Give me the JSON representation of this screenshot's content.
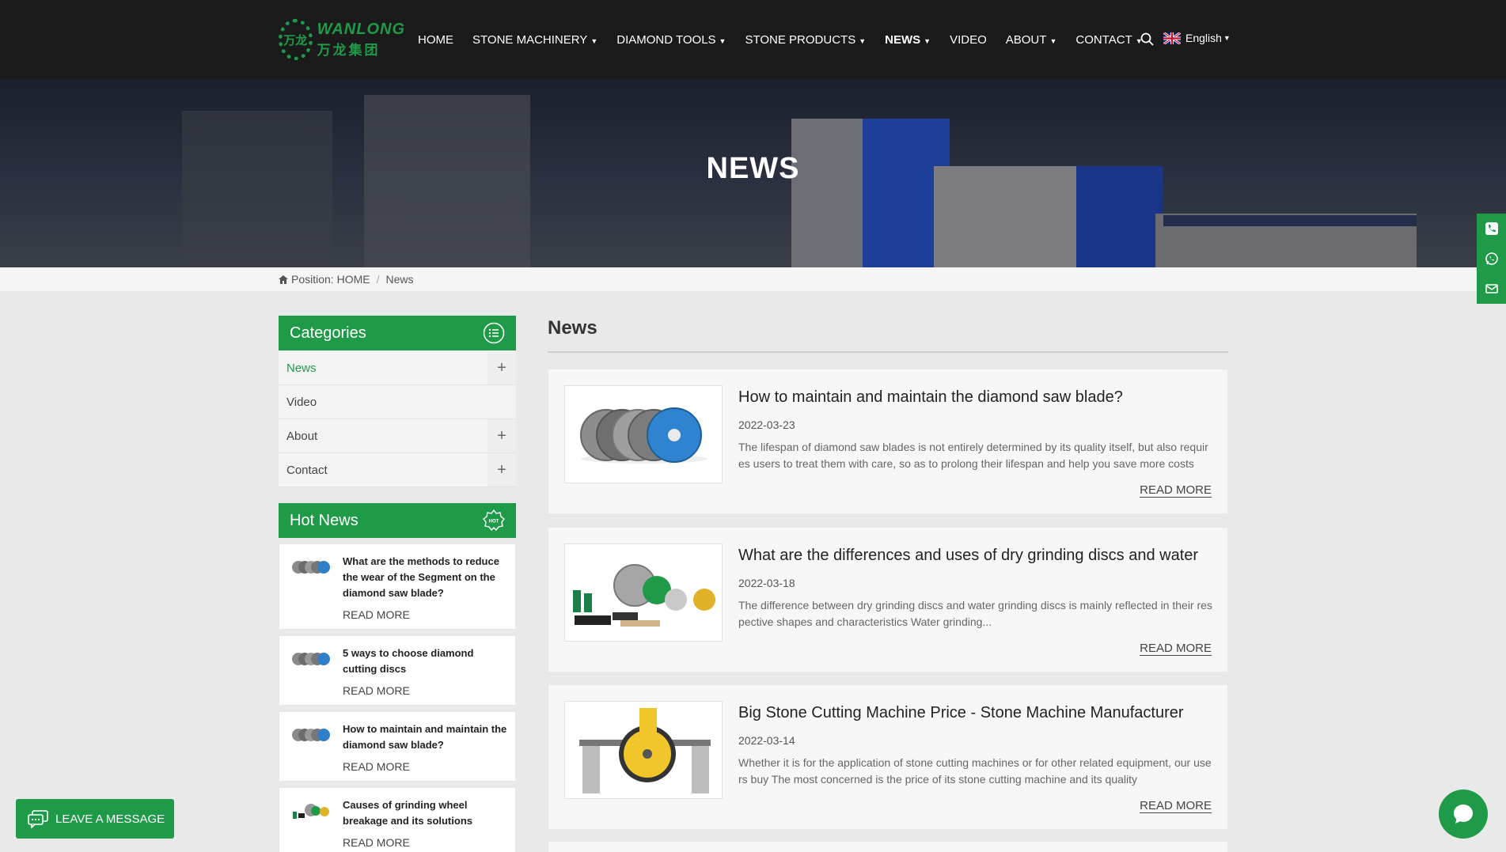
{
  "colors": {
    "brand_green": "#1f9a49",
    "header_bg": "#1a1a1a",
    "page_bg": "#e9e9e9"
  },
  "header": {
    "logo": {
      "icon_name": "wanlong-logo",
      "brand_en": "WANLONG",
      "brand_cn": "万龙集团"
    },
    "nav": [
      {
        "label": "HOME",
        "has_dropdown": false,
        "active": false
      },
      {
        "label": "STONE MACHINERY",
        "has_dropdown": true,
        "active": false
      },
      {
        "label": "DIAMOND TOOLS",
        "has_dropdown": true,
        "active": false
      },
      {
        "label": "STONE PRODUCTS",
        "has_dropdown": true,
        "active": false
      },
      {
        "label": "NEWS",
        "has_dropdown": true,
        "active": true
      },
      {
        "label": "VIDEO",
        "has_dropdown": false,
        "active": false
      },
      {
        "label": "ABOUT",
        "has_dropdown": true,
        "active": false
      },
      {
        "label": "CONTACT",
        "has_dropdown": true,
        "active": false
      }
    ],
    "search_icon": "search-icon",
    "language": {
      "label": "English",
      "flag": "uk-flag-icon"
    }
  },
  "banner": {
    "title": "NEWS"
  },
  "breadcrumb": {
    "prefix": "Position:",
    "home": "HOME",
    "current": "News"
  },
  "sidebar": {
    "categories": {
      "title": "Categories",
      "items": [
        {
          "label": "News",
          "expandable": true,
          "active": true
        },
        {
          "label": "Video",
          "expandable": false,
          "active": false
        },
        {
          "label": "About",
          "expandable": true,
          "active": false
        },
        {
          "label": "Contact",
          "expandable": true,
          "active": false
        }
      ]
    },
    "hot_news": {
      "title": "Hot News",
      "items": [
        {
          "title": "What are the methods to reduce the wear of the Segment on the diamond saw blade?",
          "more": "READ MORE"
        },
        {
          "title": "5 ways to choose diamond cutting discs",
          "more": "READ MORE"
        },
        {
          "title": "How to maintain and maintain the diamond saw blade?",
          "more": "READ MORE"
        },
        {
          "title": "Causes of grinding wheel breakage and its solutions",
          "more": "READ MORE"
        }
      ]
    }
  },
  "main": {
    "title": "News",
    "articles": [
      {
        "title": "How to maintain and maintain the diamond saw blade?",
        "date": "2022-03-23",
        "desc": "The lifespan of diamond saw blades is not entirely determined by its quality itself, but also requires users to treat them with care, so as to prolong their lifespan and help you save more costs",
        "more": "READ MORE"
      },
      {
        "title": "What are the differences and uses of dry grinding discs and water",
        "date": "2022-03-18",
        "desc": "The difference between dry grinding discs and water grinding discs is mainly reflected in their respective shapes and characteristics Water grinding...",
        "more": "READ MORE"
      },
      {
        "title": "Big Stone Cutting Machine Price - Stone Machine Manufacturer",
        "date": "2022-03-14",
        "desc": "Whether it is for the application of stone cutting machines or for other related equipment, our users buy The most concerned is the price of its stone cutting machine and its quality",
        "more": "READ MORE"
      }
    ]
  },
  "floating": {
    "leave_message": "LEAVE A MESSAGE",
    "side_icons": [
      "phone-icon",
      "whatsapp-icon",
      "email-icon"
    ],
    "chat_icon": "chat-bubble-icon"
  }
}
